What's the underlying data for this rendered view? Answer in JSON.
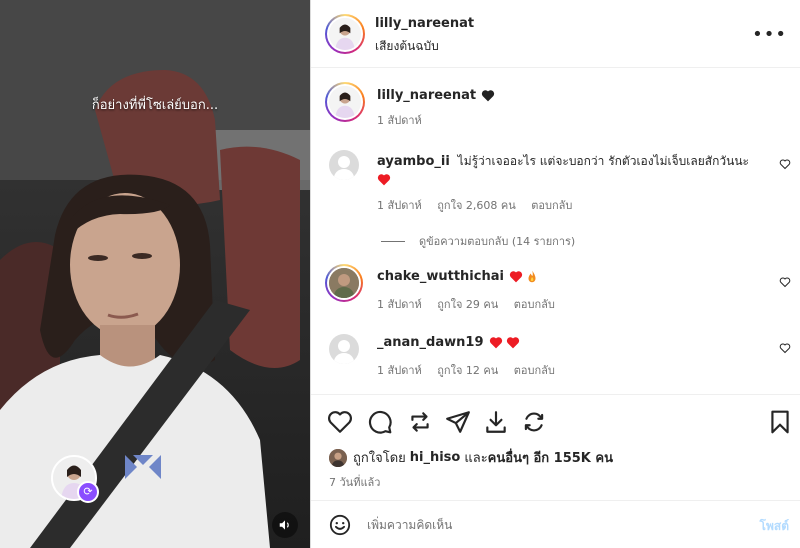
{
  "media": {
    "caption": "ก็อย่างที่พี่โซเล่ย์บอก..."
  },
  "post_header": {
    "username": "lilly_nareenat",
    "audio_label": "เสียงต้นฉบับ"
  },
  "caption_block": {
    "username": "lilly_nareenat",
    "time": "1 สัปดาห์"
  },
  "comments": [
    {
      "username": "ayambo_ii",
      "text": "ไม่รู้ว่าเจออะไร แต่จะบอกว่า รักตัวเองไม่เจ็บเลยสักวันนะ",
      "time": "1 สัปดาห์",
      "likes": "ถูกใจ 2,608 คน",
      "reply": "ตอบกลับ",
      "view_replies": "ดูข้อความตอบกลับ (14 รายการ)"
    },
    {
      "username": "chake_wutthichai",
      "time": "1 สัปดาห์",
      "likes": "ถูกใจ 29 คน",
      "reply": "ตอบกลับ"
    },
    {
      "username": "_anan_dawn19",
      "time": "1 สัปดาห์",
      "likes": "ถูกใจ 12 คน",
      "reply": "ตอบกลับ"
    }
  ],
  "liked_by": {
    "prefix": "ถูกใจโดย",
    "user": "hi_hiso",
    "and": "และ",
    "others": "คนอื่นๆ อีก 155K คน"
  },
  "posted_ago": "7 วันที่แล้ว",
  "composer": {
    "placeholder": "เพิ่มความคิดเห็น",
    "post_label": "โพสต์"
  },
  "colors": {
    "accent": "#0095f6",
    "muted": "#737373",
    "heart": "#ed1c24"
  }
}
